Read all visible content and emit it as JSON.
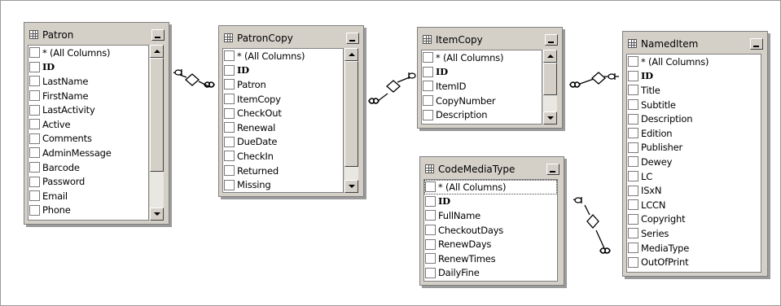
{
  "colors": {
    "frame": "#d4d0c8",
    "canvas": "#ffffff",
    "line": "#000000"
  },
  "tables": {
    "patron": {
      "title": "Patron",
      "rows": [
        "* (All Columns)",
        "ID",
        "LastName",
        "FirstName",
        "LastActivity",
        "Active",
        "Comments",
        "AdminMessage",
        "Barcode",
        "Password",
        "Email",
        "Phone"
      ]
    },
    "patroncopy": {
      "title": "PatronCopy",
      "rows": [
        "* (All Columns)",
        "ID",
        "Patron",
        "ItemCopy",
        "CheckOut",
        "Renewal",
        "DueDate",
        "CheckIn",
        "Returned",
        "Missing"
      ]
    },
    "itemcopy": {
      "title": "ItemCopy",
      "rows": [
        "* (All Columns)",
        "ID",
        "ItemID",
        "CopyNumber",
        "Description"
      ]
    },
    "codemediatype": {
      "title": "CodeMediaType",
      "rows": [
        "* (All Columns)",
        "ID",
        "FullName",
        "CheckoutDays",
        "RenewDays",
        "RenewTimes",
        "DailyFine"
      ]
    },
    "nameditem": {
      "title": "NamedItem",
      "rows": [
        "* (All Columns)",
        "ID",
        "Title",
        "Subtitle",
        "Description",
        "Edition",
        "Publisher",
        "Dewey",
        "LC",
        "ISxN",
        "LCCN",
        "Copyright",
        "Series",
        "MediaType",
        "OutOfPrint"
      ]
    }
  },
  "relationships": [
    {
      "from": "Patron",
      "to": "PatronCopy"
    },
    {
      "from": "PatronCopy",
      "to": "ItemCopy"
    },
    {
      "from": "ItemCopy",
      "to": "NamedItem"
    },
    {
      "from": "CodeMediaType",
      "to": "NamedItem"
    }
  ]
}
